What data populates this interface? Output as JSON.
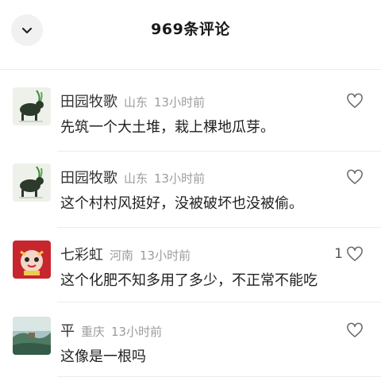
{
  "header": {
    "title": "969条评论",
    "collapse_icon": "chevron-down-icon"
  },
  "comments": [
    {
      "username": "田园牧歌",
      "location": "山东",
      "time": "13小时前",
      "text": "先筑一个大土堆，栽上棵地瓜芽。",
      "like_count": "",
      "avatar": "cattle-painting-avatar"
    },
    {
      "username": "田园牧歌",
      "location": "山东",
      "time": "13小时前",
      "text": "这个村村风挺好，没被破坏也没被偷。",
      "like_count": "",
      "avatar": "cattle-painting-avatar"
    },
    {
      "username": "七彩虹",
      "location": "河南",
      "time": "13小时前",
      "text": "这个化肥不知多用了多少，不正常不能吃",
      "like_count": "1",
      "avatar": "red-cartoon-avatar"
    },
    {
      "username": "平",
      "location": "重庆",
      "time": "13小时前",
      "text": "这像是一根吗",
      "like_count": "",
      "avatar": "landscape-avatar"
    }
  ],
  "colors": {
    "muted": "#9c9c9c",
    "divider": "#ececec",
    "button_bg": "#f1f1f1"
  }
}
